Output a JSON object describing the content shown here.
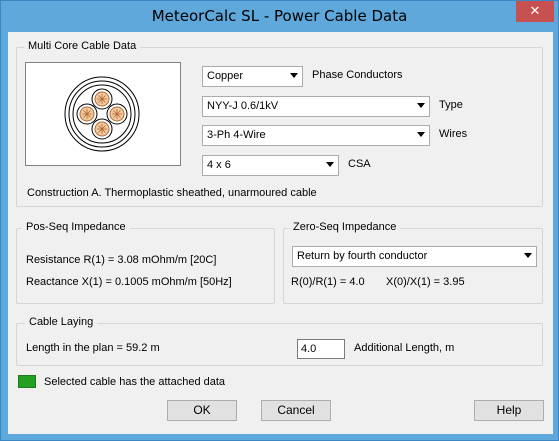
{
  "window": {
    "title": "MeteorCalc SL - Power Cable Data",
    "close_glyph": "✕",
    "titlebar_color": "#5fa8dc",
    "close_color": "#c75050"
  },
  "multi_core": {
    "legend": "Multi Core Cable Data",
    "conductor_material": "Copper",
    "phase_conductors_label": "Phase Conductors",
    "cable_type": "NYY-J 0.6/1kV",
    "type_label": "Type",
    "wires": "3-Ph  4-Wire",
    "wires_label": "Wires",
    "csa": "4 x 6",
    "csa_label": "CSA",
    "construction": "Construction A.  Thermoplastic sheathed, unarmoured cable"
  },
  "pos_seq": {
    "legend": "Pos-Seq Impedance",
    "resistance": "Resistance  R(1) =  3.08  mOhm/m [20C]",
    "reactance": "Reactance  X(1) =  0.1005  mOhm/m [50Hz]"
  },
  "zero_seq": {
    "legend": "Zero-Seq Impedance",
    "return_path": "Return by fourth conductor",
    "r_ratio": "R(0)/R(1) = 4.0",
    "x_ratio": "X(0)/X(1) = 3.95"
  },
  "laying": {
    "legend": "Cable Laying",
    "length_text": "Length in the plan = 59.2 m",
    "additional_length_value": "4.0",
    "additional_length_label": "Additional Length, m"
  },
  "status": {
    "text": "Selected cable has the attached data",
    "color": "#22a022"
  },
  "buttons": {
    "ok": "OK",
    "cancel": "Cancel",
    "help": "Help"
  }
}
